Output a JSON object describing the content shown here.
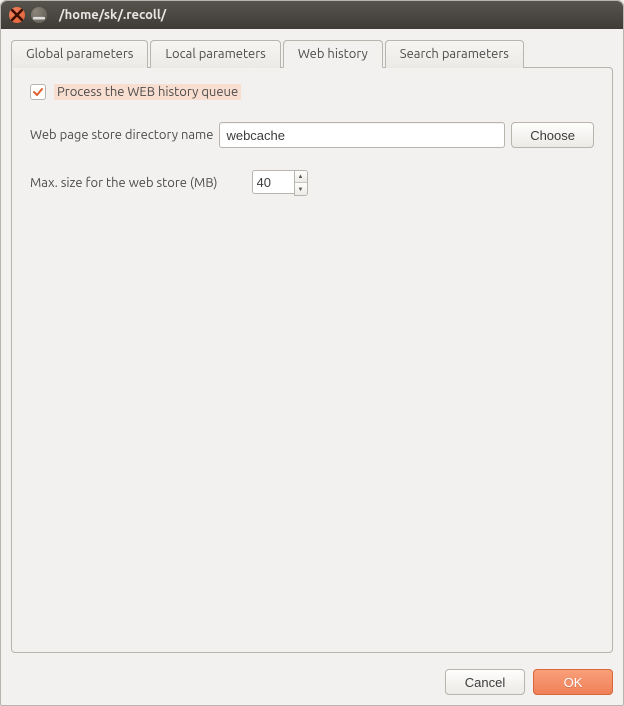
{
  "window": {
    "title": "/home/sk/.recoll/"
  },
  "tabs": {
    "items": [
      {
        "label": "Global parameters"
      },
      {
        "label": "Local parameters"
      },
      {
        "label": "Web history"
      },
      {
        "label": "Search parameters"
      }
    ],
    "active_index": 2
  },
  "web_history": {
    "process_queue": {
      "label": "Process the WEB history queue",
      "checked": true
    },
    "store_dir": {
      "label": "Web page store directory name",
      "value": "webcache",
      "choose_label": "Choose"
    },
    "max_size": {
      "label": "Max. size for the web store (MB)",
      "value": "40"
    }
  },
  "footer": {
    "cancel_label": "Cancel",
    "ok_label": "OK"
  }
}
